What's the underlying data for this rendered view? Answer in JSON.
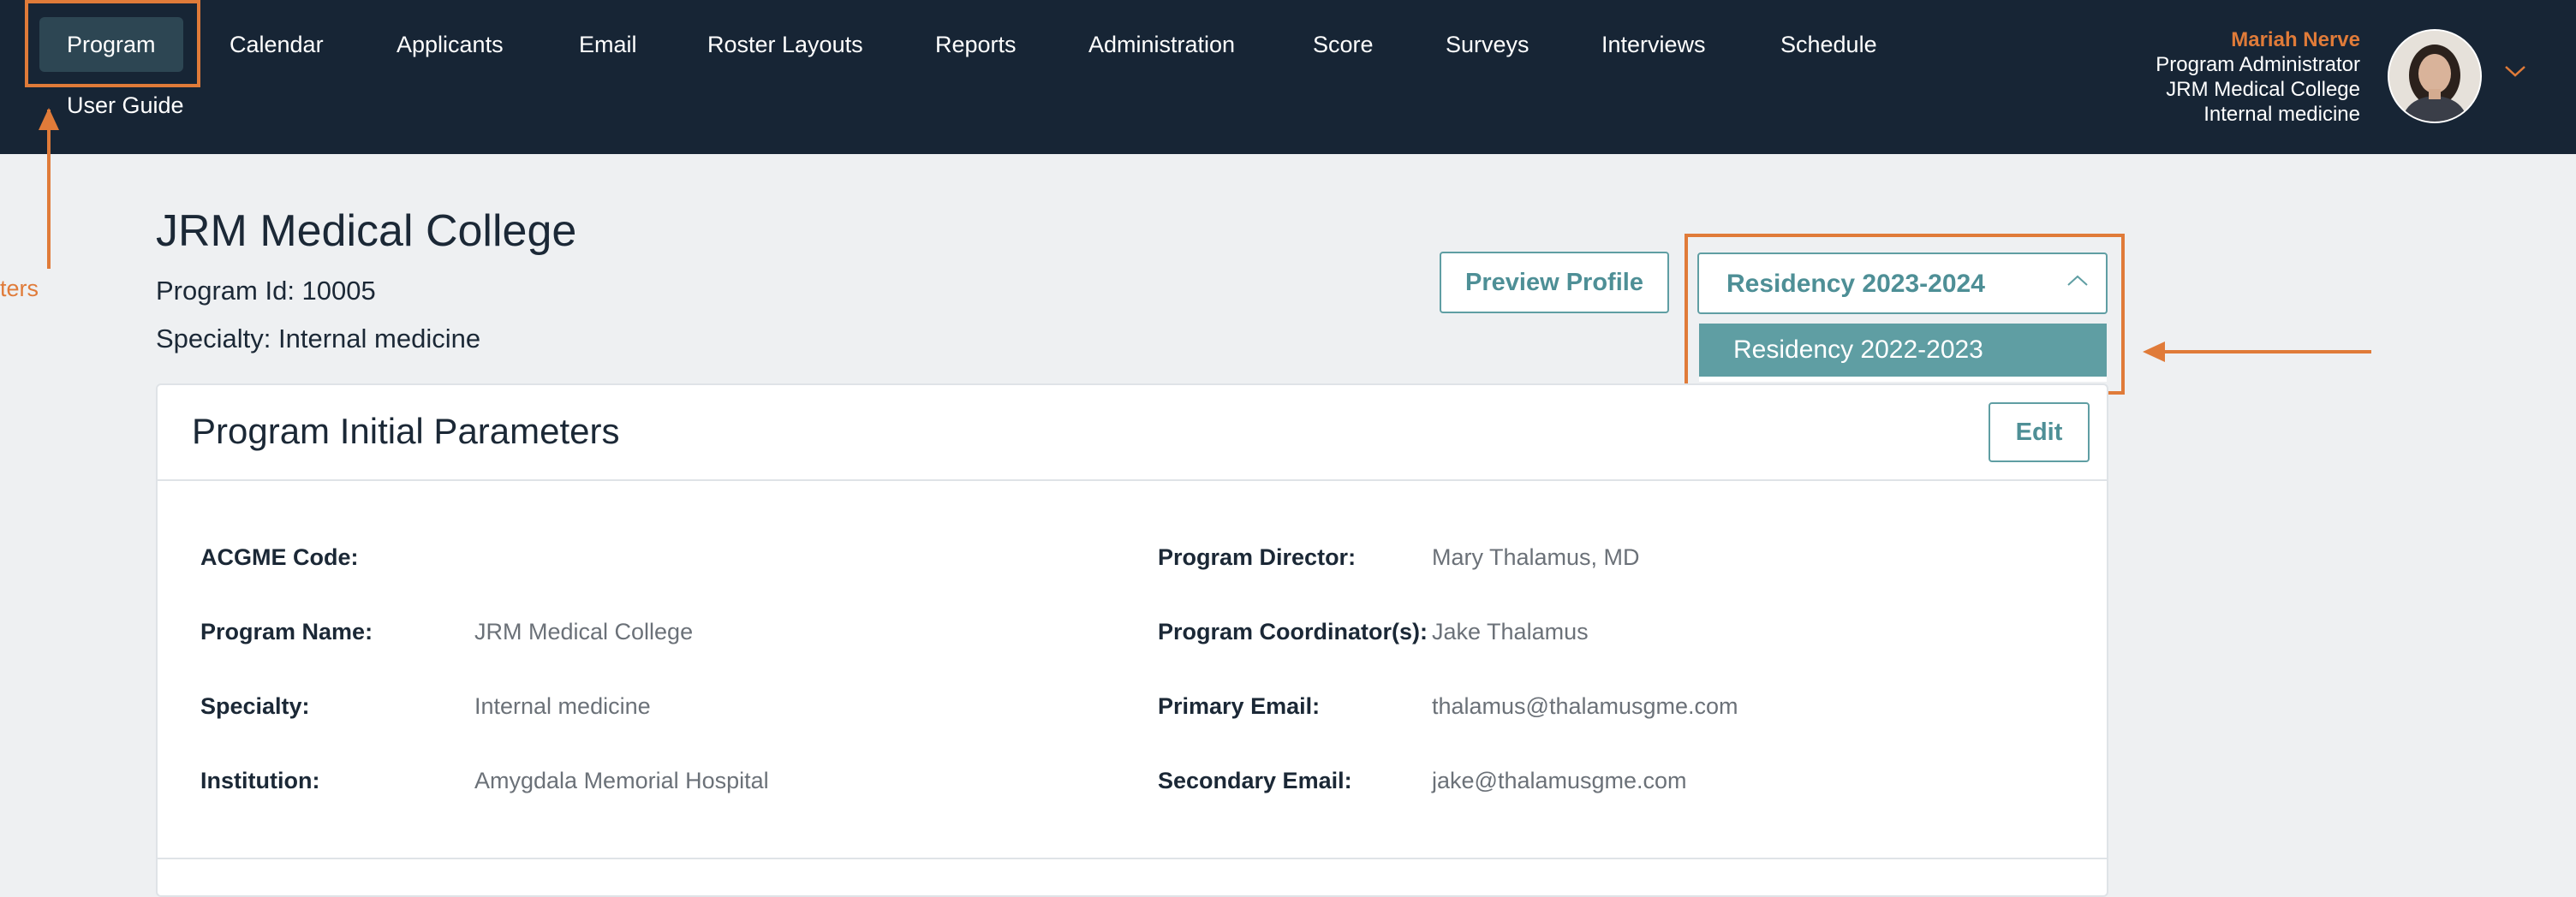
{
  "nav": {
    "items": [
      "Program",
      "Calendar",
      "Applicants",
      "Email",
      "Roster Layouts",
      "Reports",
      "Administration",
      "Score",
      "Surveys",
      "Interviews",
      "Schedule"
    ],
    "sub_item": "User Guide"
  },
  "user": {
    "name": "Mariah Nerve",
    "role": "Program Administrator",
    "institution": "JRM Medical College",
    "department": "Internal medicine"
  },
  "annotation": {
    "partial_text": "ters"
  },
  "header": {
    "title": "JRM Medical College",
    "program_id": "Program Id: 10005",
    "specialty": "Specialty: Internal medicine"
  },
  "actions": {
    "preview_label": "Preview Profile"
  },
  "season_select": {
    "value": "Residency 2023-2024",
    "options": [
      "Residency 2022-2023"
    ]
  },
  "card": {
    "title": "Program Initial Parameters",
    "edit_label": "Edit",
    "left_fields": [
      {
        "label": "ACGME Code:",
        "value": ""
      },
      {
        "label": "Program Name:",
        "value": "JRM Medical College"
      },
      {
        "label": "Specialty:",
        "value": "Internal medicine"
      },
      {
        "label": "Institution:",
        "value": "Amygdala Memorial Hospital"
      }
    ],
    "right_fields": [
      {
        "label": "Program Director:",
        "value": "Mary Thalamus, MD"
      },
      {
        "label": "Program Coordinator(s):",
        "value": "Jake Thalamus"
      },
      {
        "label": "Primary Email:",
        "value": "thalamus@thalamusgme.com"
      },
      {
        "label": "Secondary Email:",
        "value": "jake@thalamusgme.com"
      }
    ]
  },
  "colors": {
    "nav_bg": "#172535",
    "accent_teal": "#5f9ea3",
    "annotation_orange": "#e07b39"
  }
}
